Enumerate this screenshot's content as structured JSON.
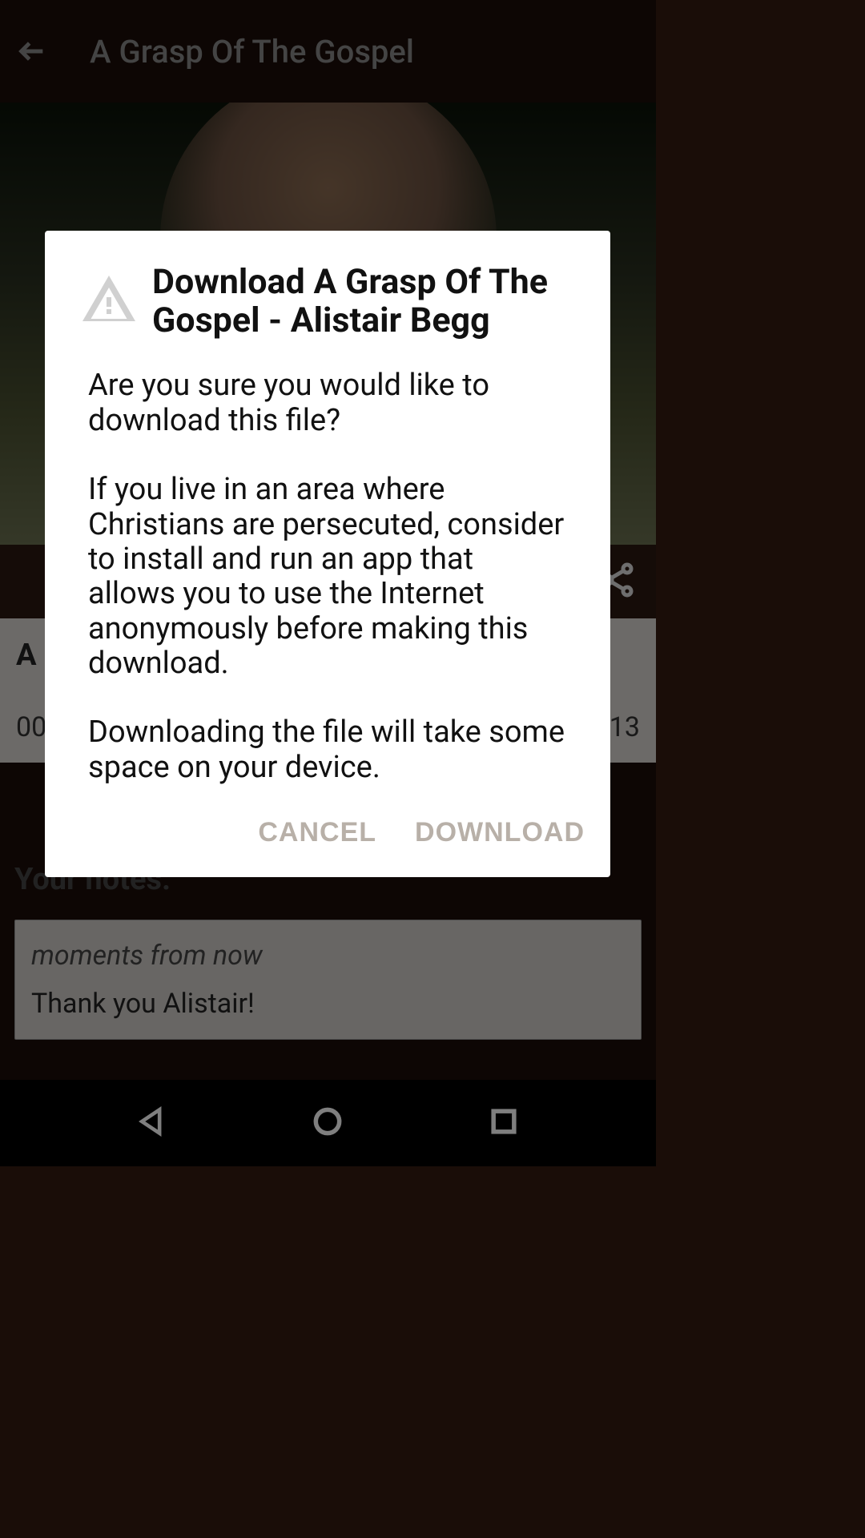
{
  "header": {
    "title": "A Grasp Of The Gospel"
  },
  "info": {
    "title_truncated": "A (",
    "time_left": "00",
    "time_right": "13"
  },
  "notes": {
    "label": "Your notes:",
    "timestamp": "moments from now",
    "text": "Thank you Alistair!"
  },
  "dialog": {
    "title": "Download A Grasp Of The Gospel - Alistair Begg",
    "body": "Are you sure you would like to download this file?\n\nIf you live in an area where Christians are persecuted, consider to install and run an app that allows you to use the Internet anonymously before making this download.\n\nDownloading the file will take some space on your device.",
    "cancel_label": "CANCEL",
    "download_label": "DOWNLOAD"
  }
}
